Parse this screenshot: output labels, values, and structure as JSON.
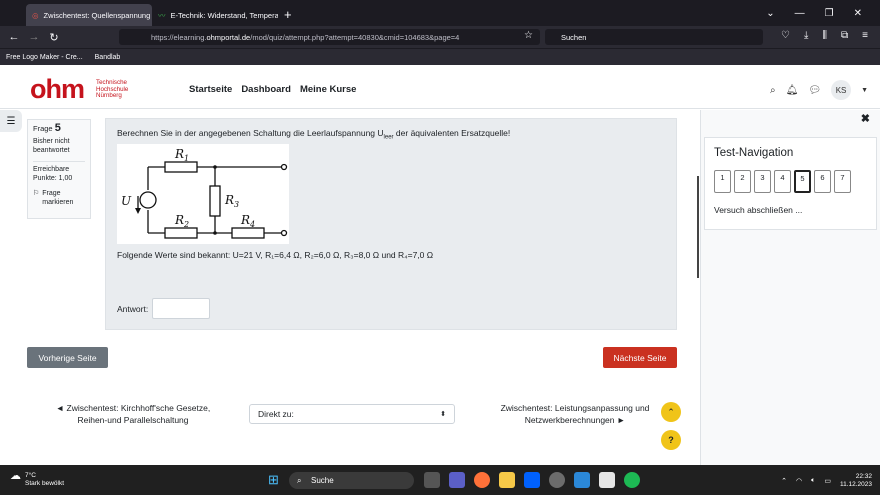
{
  "browser": {
    "tabs": [
      {
        "label": "Zwischentest: Quellenspannung",
        "active": true
      },
      {
        "label": "E-Technik: Widerstand, Tempera",
        "active": false
      }
    ],
    "url_prefix": "https://elearning.",
    "url_domain": "ohmportal.de",
    "url_suffix": "/mod/quiz/attempt.php?attempt=40830&cmid=104683&page=4",
    "search_placeholder": "Suchen",
    "bookmarks": [
      "Free Logo Maker - Cre...",
      "Bandlab"
    ]
  },
  "site": {
    "logo_text": "ohm",
    "logo_sub": [
      "Technische",
      "Hochschule",
      "Nürnberg"
    ],
    "nav": [
      "Startseite",
      "Dashboard",
      "Meine Kurse"
    ],
    "user_initials": "KS"
  },
  "question_info": {
    "frage_label": "Frage",
    "number": "5",
    "status": "Bisher nicht beantwortet",
    "points": "Erreichbare Punkte: 1,00",
    "flag": "Frage markieren"
  },
  "question": {
    "text_before": "Berechnen Sie in der angegebenen Schaltung die Leerlaufspannung U",
    "text_sub": "leer",
    "text_after": " der äquivalenten Ersatzquelle!",
    "circuit_labels": {
      "r1": "R",
      "r1_sub": "1",
      "r2": "R",
      "r2_sub": "2",
      "r3": "R",
      "r3_sub": "3",
      "r4": "R",
      "r4_sub": "4",
      "u": "U"
    },
    "values_text": "Folgende Werte sind bekannt: U=21 V, R₁=6,4 Ω, R₂=6,0 Ω, R₃=8,0 Ω und R₄=7,0 Ω",
    "answer_label": "Antwort:",
    "answer_value": ""
  },
  "buttons": {
    "prev": "Vorherige Seite",
    "next": "Nächste Seite"
  },
  "activity_nav": {
    "prev": "◄ Zwischentest: Kirchhoff'sche Gesetze, Reihen-und Parallelschaltung",
    "jump_label": "Direkt zu:",
    "next": "Zwischentest: Leistungsanpassung und Netzwerkberechnungen ►"
  },
  "drawer": {
    "title": "Test-Navigation",
    "questions": [
      "1",
      "2",
      "3",
      "4",
      "5",
      "6",
      "7"
    ],
    "current": "5",
    "finish": "Versuch abschließen ..."
  },
  "taskbar": {
    "temperature": "7°C",
    "weather": "Stark bewölkt",
    "search": "Suche",
    "time": "22:32",
    "date": "11.12.2023"
  }
}
